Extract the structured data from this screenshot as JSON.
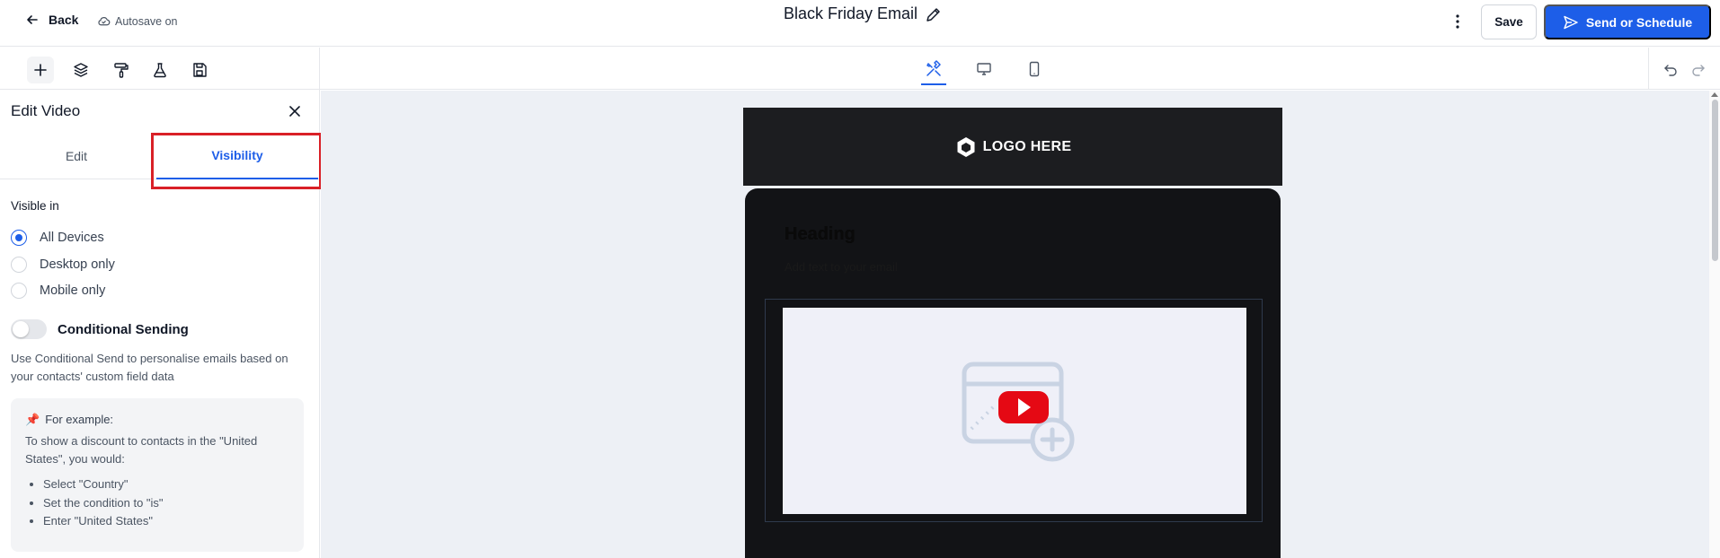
{
  "topbar": {
    "back_label": "Back",
    "autosave_label": "Autosave on",
    "title": "Black Friday Email",
    "save_label": "Save",
    "send_label": "Send or Schedule"
  },
  "toolbar": {
    "tools": [
      "plus-icon",
      "layers-icon",
      "paint-roller-icon",
      "flask-icon",
      "save-disk-icon"
    ],
    "views": [
      "tools-icon",
      "desktop-icon",
      "mobile-icon"
    ],
    "history": [
      "undo-icon",
      "redo-icon"
    ]
  },
  "panel": {
    "title": "Edit Video",
    "tabs": [
      {
        "label": "Edit",
        "active": false
      },
      {
        "label": "Visibility",
        "active": true
      }
    ],
    "visible_in_label": "Visible in",
    "options": [
      {
        "label": "All Devices",
        "checked": true
      },
      {
        "label": "Desktop only",
        "checked": false
      },
      {
        "label": "Mobile only",
        "checked": false
      }
    ],
    "conditional_label": "Conditional Sending",
    "conditional_enabled": false,
    "help_text": "Use Conditional Send to personalise emails based on your contacts' custom field data",
    "example": {
      "pin": "📌",
      "heading": "For example:",
      "intro": "To show a discount to contacts in the \"United States\", you would:",
      "steps": [
        "Select \"Country\"",
        "Set the condition to \"is\"",
        "Enter \"United States\""
      ]
    }
  },
  "email": {
    "logo_text": "LOGO HERE",
    "heading": "Heading",
    "subtext": "Add text to your email"
  },
  "colors": {
    "accent": "#1d5ee8",
    "highlight": "#d92027",
    "play": "#e50914"
  }
}
